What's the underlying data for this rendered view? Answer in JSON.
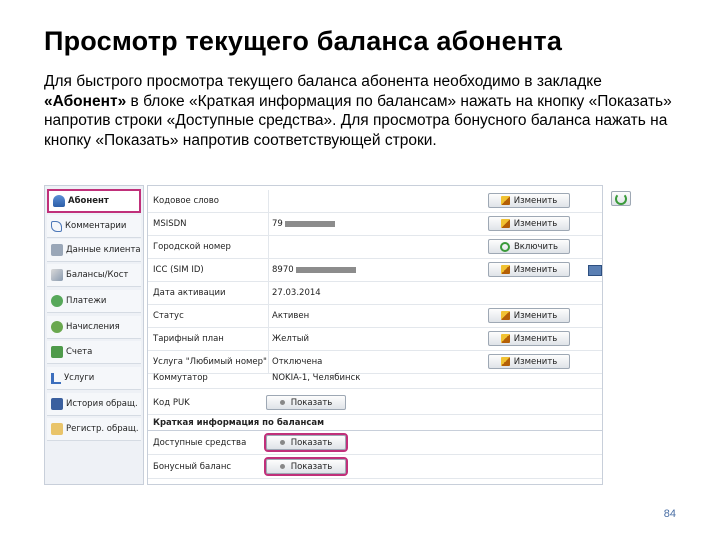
{
  "slide": {
    "title": "Просмотр текущего баланса абонента",
    "text_parts": [
      "Для быстрого просмотра текущего баланса абонента необходимо в закладке ",
      "«Абонент»",
      " в блоке «Краткая информация по балансам» нажать на кнопку «Показать» напротив строки «Доступные средства». Для просмотра бонусного баланса нажать на кнопку «Показать» напротив соответствующей строки."
    ],
    "page_number": "84"
  },
  "sidebar": {
    "items": [
      {
        "label": "Абонент",
        "icon": "user-icon"
      },
      {
        "label": "Комментарии",
        "icon": "comment-icon"
      },
      {
        "label": "Данные клиента",
        "icon": "client-data-icon"
      },
      {
        "label": "Балансы/Кост",
        "icon": "balance-icon"
      },
      {
        "label": "Платежи",
        "icon": "payments-icon"
      },
      {
        "label": "Начисления",
        "icon": "charges-icon"
      },
      {
        "label": "Счета",
        "icon": "bills-icon"
      },
      {
        "label": "Услуги",
        "icon": "services-icon"
      },
      {
        "label": "История обращ.",
        "icon": "history-icon"
      },
      {
        "label": "Регистр. обращ.",
        "icon": "register-icon"
      }
    ]
  },
  "fields": {
    "rows": [
      {
        "label": "Кодовое слово",
        "value": "",
        "button": "Изменить"
      },
      {
        "label": "MSISDN",
        "value": "79",
        "button": "Изменить"
      },
      {
        "label": "Городской номер",
        "value": "",
        "button": "Включить"
      },
      {
        "label": "ICC (SIM ID)",
        "value": "8970",
        "button": "Изменить"
      },
      {
        "label": "Дата активации",
        "value": "27.03.2014",
        "button": ""
      },
      {
        "label": "Статус",
        "value": "Активен",
        "button": "Изменить"
      },
      {
        "label": "Тарифный план",
        "value": "Желтый",
        "button": "Изменить"
      },
      {
        "label": "Услуга \"Любимый номер\"",
        "value": "Отключена",
        "button": "Изменить"
      },
      {
        "label": "Коммутатор",
        "value": "NOKIA-1, Челябинск",
        "button": ""
      }
    ],
    "puk": {
      "label": "Код PUK",
      "button": "Показать"
    }
  },
  "balances": {
    "header": "Краткая информация по балансам",
    "available": {
      "label": "Доступные средства",
      "button": "Показать"
    },
    "bonus": {
      "label": "Бонусный баланс",
      "button": "Показать"
    }
  },
  "colors": {
    "highlight": "#c0307a",
    "accent": "#4a6fa5"
  }
}
